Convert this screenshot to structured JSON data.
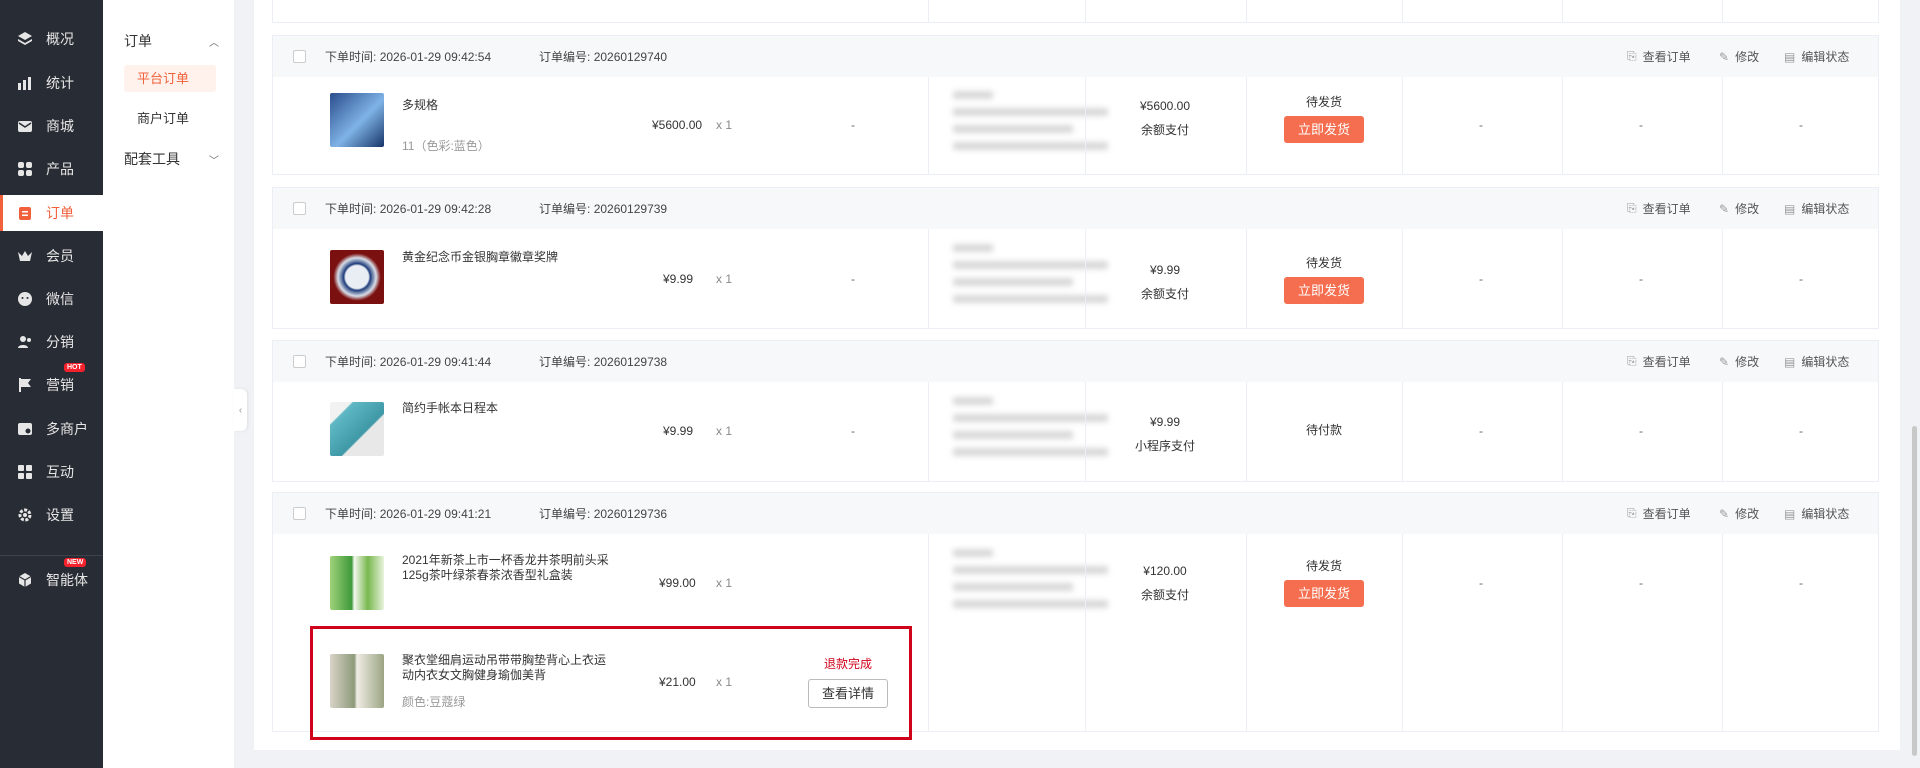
{
  "sidebar": {
    "items": [
      {
        "label": "概况",
        "icon": "layers-icon"
      },
      {
        "label": "统计",
        "icon": "chart-icon"
      },
      {
        "label": "商城",
        "icon": "mail-icon"
      },
      {
        "label": "产品",
        "icon": "grid-icon"
      },
      {
        "label": "订单",
        "icon": "clipboard-icon"
      },
      {
        "label": "会员",
        "icon": "crown-icon"
      },
      {
        "label": "微信",
        "icon": "wechat-icon"
      },
      {
        "label": "分销",
        "icon": "users-icon"
      },
      {
        "label": "营销",
        "icon": "flag-icon",
        "badge": "HOT"
      },
      {
        "label": "多商户",
        "icon": "store-icon"
      },
      {
        "label": "互动",
        "icon": "apps-icon"
      },
      {
        "label": "设置",
        "icon": "gear-icon"
      },
      {
        "label": "智能体",
        "icon": "cube-icon",
        "badge": "NEW"
      }
    ],
    "accent": "#f0613b"
  },
  "submenu": {
    "group1": "订单",
    "items": [
      "平台订单",
      "商户订单"
    ],
    "group2": "配套工具"
  },
  "header_labels": {
    "time_prefix": "下单时间:",
    "no_prefix": "订单编号:"
  },
  "actions": {
    "view": "查看订单",
    "edit": "修改",
    "edit_status": "编辑状态"
  },
  "ship_label": "立即发货",
  "dash": "-",
  "orders": [
    {
      "time": "2026-01-29 09:42:54",
      "no": "20260129740",
      "products": [
        {
          "name": "多规格",
          "sub": "11（色彩:蓝色）",
          "price": "¥5600.00",
          "qty": "x 1"
        }
      ],
      "total": "¥5600.00",
      "pay": "余额支付",
      "status": "待发货"
    },
    {
      "time": "2026-01-29 09:42:28",
      "no": "20260129739",
      "products": [
        {
          "name": "黄金纪念币金银胸章徽章奖牌",
          "sub": "",
          "price": "¥9.99",
          "qty": "x 1"
        }
      ],
      "total": "¥9.99",
      "pay": "余额支付",
      "status": "待发货"
    },
    {
      "time": "2026-01-29 09:41:44",
      "no": "20260129738",
      "products": [
        {
          "name": "简约手帐本日程本",
          "sub": "",
          "price": "¥9.99",
          "qty": "x 1"
        }
      ],
      "total": "¥9.99",
      "pay": "小程序支付",
      "status": "待付款"
    },
    {
      "time": "2026-01-29 09:41:21",
      "no": "20260129736",
      "products": [
        {
          "name": "2021年新茶上市一杯香龙井茶明前头采125g茶叶绿茶春茶浓香型礼盒装",
          "sub": "",
          "price": "¥99.00",
          "qty": "x 1"
        },
        {
          "name": "聚衣堂细肩运动吊带带胸垫背心上衣运动内衣女文胸健身瑜伽美背",
          "sub": "颜色:豆蔻绿",
          "price": "¥21.00",
          "qty": "x 1",
          "refund": "退款完成",
          "detail": "查看详情"
        }
      ],
      "total": "¥120.00",
      "pay": "余额支付",
      "status": "待发货"
    }
  ]
}
